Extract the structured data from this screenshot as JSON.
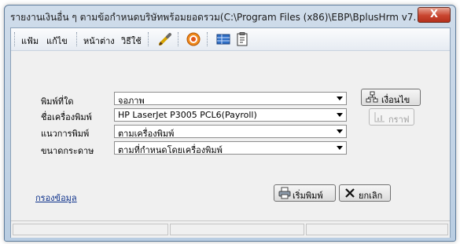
{
  "window": {
    "title": "รายงานเงินอื่น ๆ ตามข้อกำหนดบริษัทพร้อมยอดรวม(C:\\Program Files (x86)\\EBP\\BplusHrm v7...",
    "close_label": "X"
  },
  "menu": {
    "file": "แฟ้ม",
    "edit": "แก้ไข",
    "window": "หน้าต่าง",
    "help": "วิธีใช้"
  },
  "toolbar": {
    "icons": [
      "pen-icon",
      "target-icon",
      "table-icon",
      "clipboard-icon"
    ]
  },
  "form": {
    "print_to_label": "พิมพ์ที่ใด",
    "print_to_value": "จอภาพ",
    "printer_label": "ชื่อเครื่องพิมพ์",
    "printer_value": "HP LaserJet P3005 PCL6(Payroll)",
    "orientation_label": "แนวการพิมพ์",
    "orientation_value": "ตามเครื่องพิมพ์",
    "paper_label": "ขนาดกระดาษ",
    "paper_value": "ตามที่กำหนดโดยเครื่องพิมพ์"
  },
  "buttons": {
    "condition": "เงื่อนไข",
    "graph": "กราฟ",
    "print": "เริ่มพิมพ์",
    "cancel": "ยกเลิก"
  },
  "filter_link": "กรองข้อมูล",
  "colors": {
    "link": "#0b2f8a",
    "close": "#c9452f"
  }
}
